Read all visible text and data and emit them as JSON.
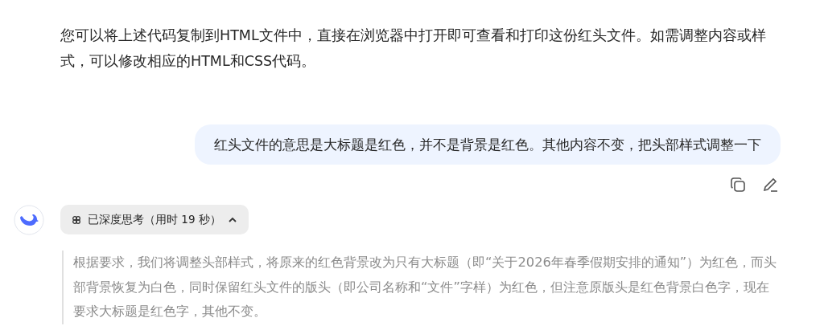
{
  "previous_reply": {
    "text": "您可以将上述代码复制到HTML文件中，直接在浏览器中打开即可查看和打印这份红头文件。如需调整内容或样式，可以修改相应的HTML和CSS代码。"
  },
  "user_message": {
    "text": "红头文件的意思是大标题是红色，并不是背景是红色。其他内容不变，把头部样式调整一下"
  },
  "reply": {
    "thinking": {
      "label": "已深度思考（用时 19 秒）",
      "expanded": true
    },
    "thought": "根据要求，我们将调整头部样式，将原来的红色背景改为只有大标题（即“关于2026年春季假期安排的通知”）为红色，而头部背景恢复为白色，同时保留红头文件的版头（即公司名称和“文件”字样）为红色，但注意原版头是红色背景白色字，现在要求大标题是红色字，其他不变。"
  }
}
